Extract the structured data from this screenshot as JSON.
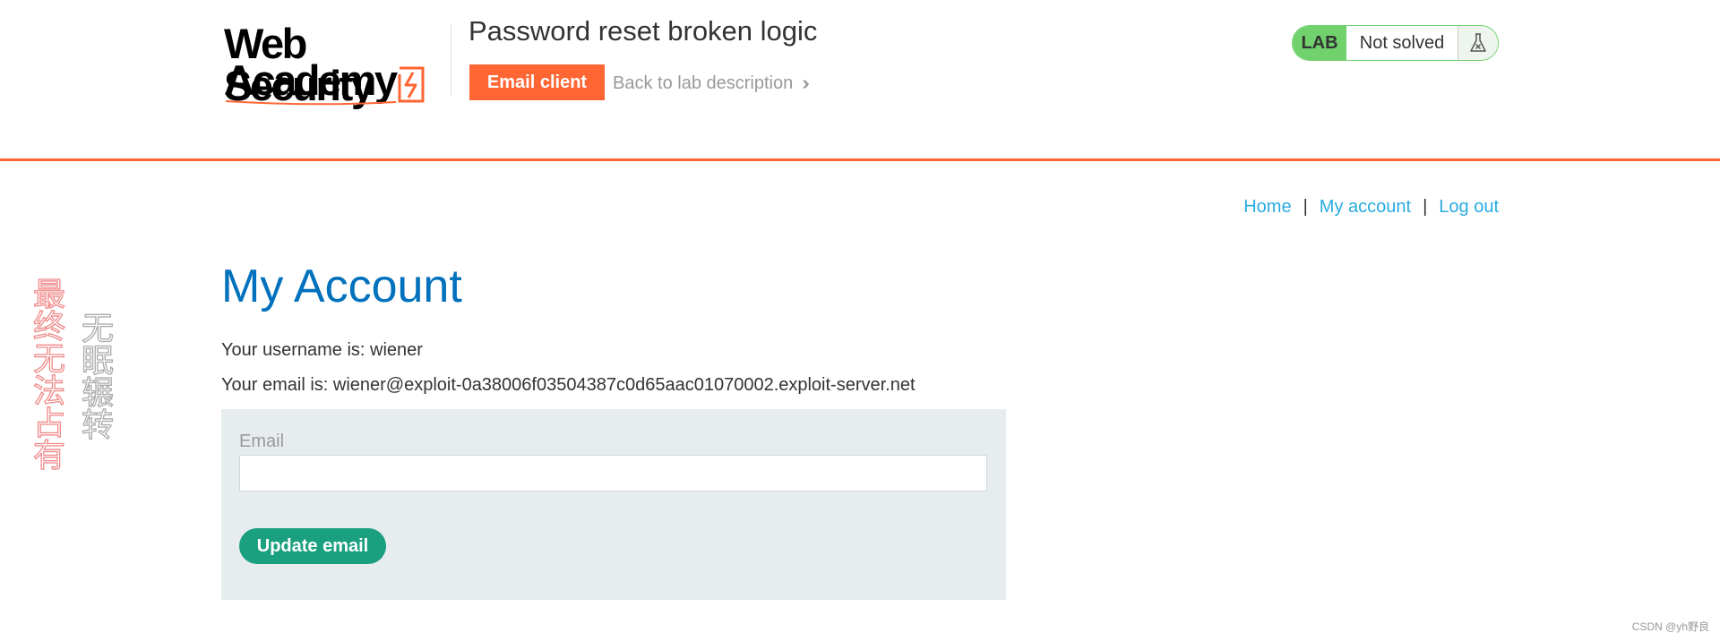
{
  "header": {
    "logo_line1": "Web Security",
    "logo_line2": "Academy",
    "lab_title": "Password reset broken logic",
    "email_client_label": "Email client",
    "back_link_label": "Back to lab description",
    "lab_badge": "LAB",
    "lab_status": "Not solved",
    "accent_color": "#ff6633",
    "status_color": "#70d16d"
  },
  "nav": {
    "home": "Home",
    "separator": "|",
    "my_account": "My account",
    "log_out": "Log out"
  },
  "main": {
    "title": "My Account",
    "username_line": "Your username is: wiener",
    "email_line": "Your email is: wiener@exploit-0a38006f03504387c0d65aac01070002.exploit-server.net",
    "form": {
      "email_label": "Email",
      "email_value": "",
      "submit_label": "Update email",
      "submit_color": "#1aa07f"
    }
  },
  "side_text": {
    "red": [
      "最",
      "终",
      "无",
      "法",
      "占",
      "有"
    ],
    "gray": [
      "无",
      "眠",
      "辗",
      "转"
    ]
  },
  "watermark": "CSDN @yh野良"
}
